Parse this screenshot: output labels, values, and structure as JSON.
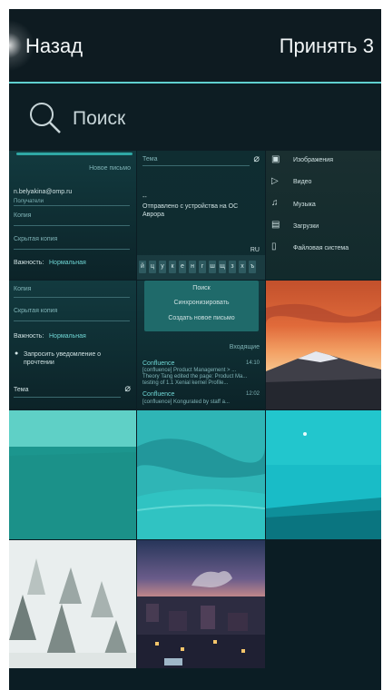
{
  "header": {
    "back_label": "Назад",
    "accept_label": "Принять 3"
  },
  "search": {
    "placeholder": "Поиск"
  },
  "thumbs": {
    "email_form": {
      "new_letter": "Новое письмо",
      "email": "n.belyakina@omp.ru",
      "recipients": "Получатели",
      "copy": "Копия",
      "hidden_copy": "Скрытая копия",
      "importance": "Важность:",
      "importance_value": "Нормальная"
    },
    "email_compose": {
      "subject": "Тема",
      "signature_line": "--",
      "signature": "Отправлено с устройства на ОС",
      "signature2": "Аврора",
      "lang": "RU",
      "keys": [
        "й",
        "ц",
        "у",
        "к",
        "е",
        "н",
        "г",
        "ш",
        "щ",
        "з",
        "х",
        "ъ"
      ]
    },
    "files_menu": {
      "items": [
        "Изображения",
        "Видео",
        "Музыка",
        "Загрузки",
        "Файловая система"
      ]
    },
    "email_form2": {
      "copy": "Копия",
      "hidden_copy": "Скрытая копия",
      "importance": "Важность:",
      "importance_value": "Нормальная",
      "request_notice": "Запросить уведомление о",
      "request_notice2": "прочтении",
      "subject": "Тема"
    },
    "inbox": {
      "menu": [
        "Поиск",
        "Синхронизировать",
        "Создать новое письмо"
      ],
      "folder": "Входящие",
      "msg1_from": "Confluence",
      "msg1_time": "14:10",
      "msg1_line1": "[confluence] Product Management > ...",
      "msg1_line2": "Theory Tang edited the page: Product Ma...",
      "msg1_line3": "testing of 1.1 Xenial kernel Profile...",
      "msg2_from": "Confluence",
      "msg2_time": "12:02",
      "msg2_line1": "[confluence] Kongurated by staff a..."
    }
  }
}
